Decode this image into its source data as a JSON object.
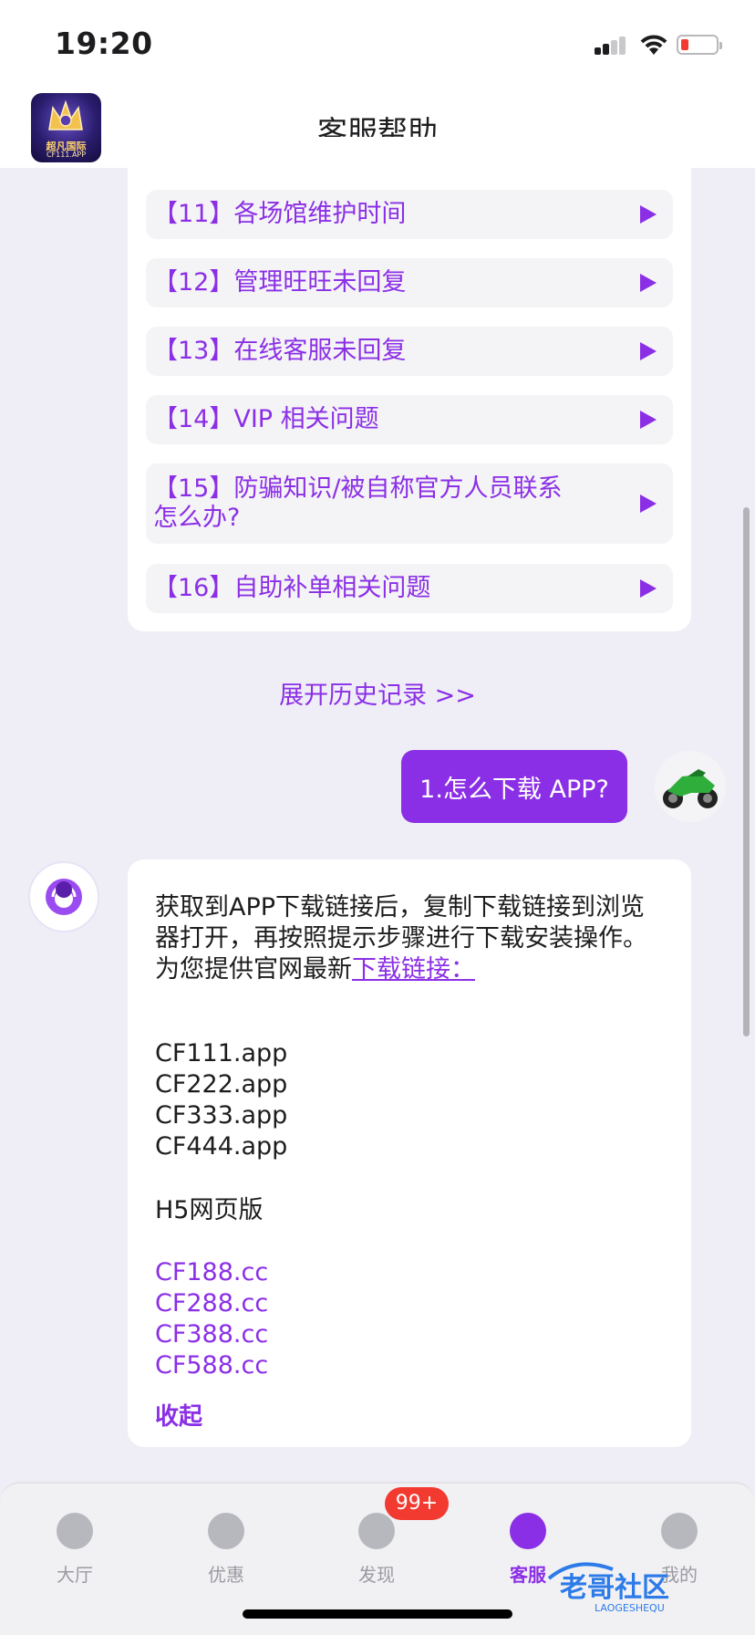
{
  "status_bar": {
    "time": "19:20",
    "battery_color": "#f23a30"
  },
  "header": {
    "title": "客服帮助",
    "logo_text": "超凡国际",
    "logo_subtext": "CF111.APP"
  },
  "faq": {
    "items": [
      {
        "label": "【11】各场馆维护时间"
      },
      {
        "label": "【12】管理旺旺未回复"
      },
      {
        "label": "【13】在线客服未回复"
      },
      {
        "label": "【14】VIP 相关问题"
      },
      {
        "label": "【15】防骗知识/被自称官方人员联系怎么办?"
      },
      {
        "label": "【16】自助补单相关问题"
      }
    ]
  },
  "expand_history": "展开历史记录 >>",
  "user_message": "1.怎么下载 APP?",
  "agent_message": {
    "text": "获取到APP下载链接后，复制下载链接到浏览器打开，再按照提示步骤进行下载安装操作。",
    "prefix": "为您提供官网最新",
    "link": "下载链接：",
    "app_links": [
      "CF111.app",
      "CF222.app",
      "CF333.app",
      "CF444.app"
    ],
    "h5_label": "H5网页版",
    "h5_links": [
      "CF188.cc",
      "CF288.cc",
      "CF388.cc",
      "CF588.cc"
    ],
    "collapse": "收起"
  },
  "tabs": [
    {
      "label": "大厅",
      "icon": "home-icon"
    },
    {
      "label": "优惠",
      "icon": "star-icon"
    },
    {
      "label": "发现",
      "icon": "compass-icon"
    },
    {
      "label": "客服",
      "icon": "service-icon",
      "active": true
    },
    {
      "label": "我的",
      "icon": "user-icon"
    }
  ],
  "badge": "99+",
  "accent_color": "#8b2fe6",
  "watermark_text": "老哥社区"
}
